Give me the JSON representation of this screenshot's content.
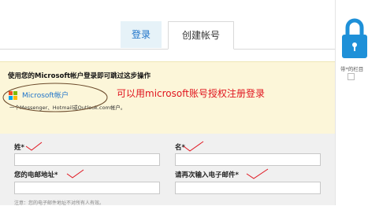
{
  "tabs": {
    "login_label": "登录",
    "create_label": "创建帐号"
  },
  "banner": {
    "heading": "使用您的Microsoft帐户登录即可跳过这步操作",
    "ms_account_link": "Microsoft帐户",
    "ms_desc": "一个Messenger、Hotmail或Outlook.com帐户。",
    "red_note": "可以用microsoft账号授权注册登录"
  },
  "form": {
    "last_name_label": "姓*",
    "first_name_label": "名*",
    "email_label": "您的电邮地址*",
    "email_confirm_label": "请再次输入电子邮件*",
    "privacy_note": "注意：您的电子邮件地址不对所有人有效。",
    "last_name_value": "",
    "first_name_value": "",
    "email_value": "",
    "email_confirm_value": ""
  },
  "right_panel": {
    "text": "带*的栏目"
  },
  "colors": {
    "accent": "#1e73c9",
    "annotation_red": "#e0141e",
    "banner_bg": "#fcf6d9"
  },
  "icons": [
    "microsoft-logo-icon",
    "lock-icon"
  ]
}
